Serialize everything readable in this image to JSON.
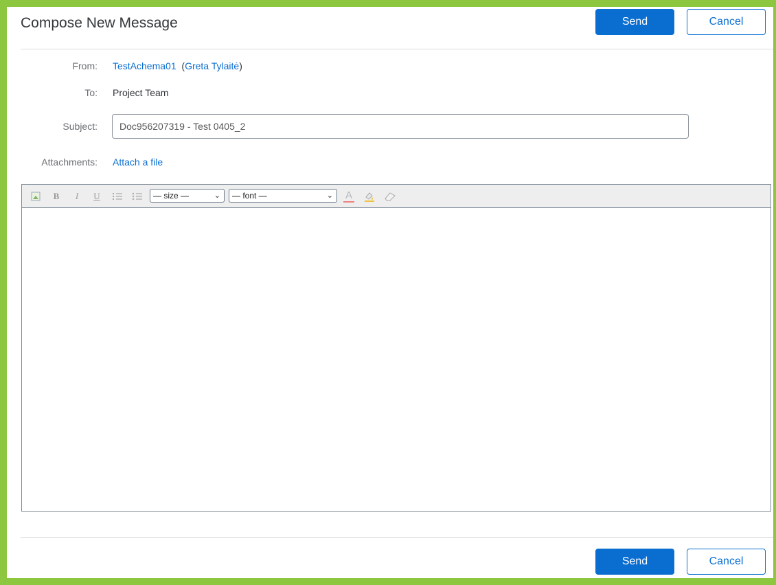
{
  "header": {
    "title": "Compose New Message",
    "send_label": "Send",
    "cancel_label": "Cancel"
  },
  "form": {
    "from_label": "From:",
    "from_user": "TestAchema01",
    "from_name_open": "(",
    "from_name": "Greta Tylaitė",
    "from_name_close": ")",
    "to_label": "To:",
    "to_value": "Project Team",
    "subject_label": "Subject:",
    "subject_value": "Doc956207319 - Test 0405_2",
    "attachments_label": "Attachments:",
    "attach_link": "Attach a file"
  },
  "toolbar": {
    "bold": "B",
    "italic": "I",
    "underline": "U",
    "size_select": "— size —",
    "font_select": "— font —",
    "font_color_glyph": "A"
  },
  "footer": {
    "send_label": "Send",
    "cancel_label": "Cancel"
  },
  "colors": {
    "accent": "#0a6ed1",
    "frame": "#8dc63f"
  }
}
